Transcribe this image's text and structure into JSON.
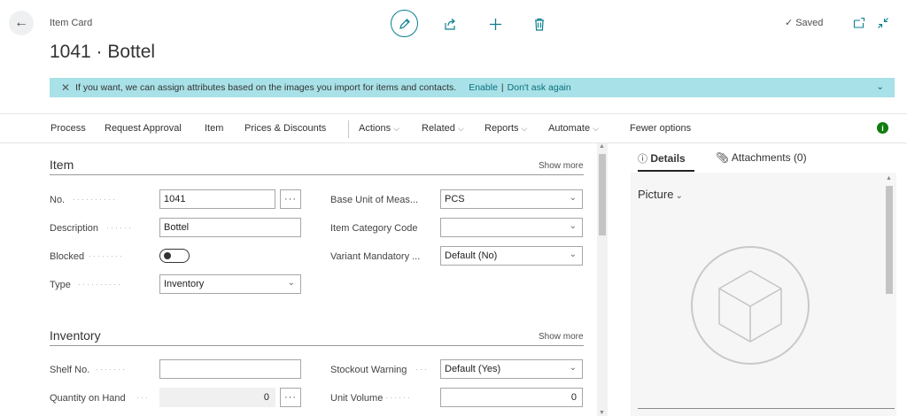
{
  "header": {
    "breadcrumb": "Item Card",
    "title": "1041 · Bottel",
    "saved_label": "Saved",
    "icons": [
      "back-arrow-icon",
      "pencil-icon",
      "share-icon",
      "plus-icon",
      "trash-icon",
      "check-icon",
      "open-new-window-icon",
      "collapse-icon"
    ]
  },
  "banner": {
    "message": "If you want, we can assign attributes based on the images you import for items and contacts.",
    "enable_label": "Enable",
    "separator": "|",
    "dont_ask_label": "Don't ask again"
  },
  "actionbar": {
    "process": "Process",
    "request_approval": "Request Approval",
    "item": "Item",
    "prices_discounts": "Prices & Discounts",
    "actions": "Actions",
    "related": "Related",
    "reports": "Reports",
    "automate": "Automate",
    "fewer_options": "Fewer options"
  },
  "item_section": {
    "title": "Item",
    "show_more": "Show more",
    "fields": {
      "no_label": "No.",
      "no_value": "1041",
      "description_label": "Description",
      "description_value": "Bottel",
      "blocked_label": "Blocked",
      "blocked_value": false,
      "type_label": "Type",
      "type_value": "Inventory",
      "base_unit_label": "Base Unit of Meas...",
      "base_unit_value": "PCS",
      "item_category_label": "Item Category Code",
      "item_category_value": "",
      "variant_mandatory_label": "Variant Mandatory ...",
      "variant_mandatory_value": "Default (No)"
    }
  },
  "inventory_section": {
    "title": "Inventory",
    "show_more": "Show more",
    "fields": {
      "shelf_no_label": "Shelf No.",
      "shelf_no_value": "",
      "qty_on_hand_label": "Quantity on Hand",
      "qty_on_hand_value": "0",
      "stockout_label": "Stockout Warning",
      "stockout_value": "Default (Yes)",
      "unit_volume_label": "Unit Volume",
      "unit_volume_value": "0"
    }
  },
  "factbox": {
    "details_tab": "Details",
    "attachments_tab": "Attachments (0)",
    "picture_title": "Picture"
  },
  "colors": {
    "accent": "#0a7f8f",
    "banner_bg": "#a8e1e7",
    "info_green": "#107c10"
  }
}
